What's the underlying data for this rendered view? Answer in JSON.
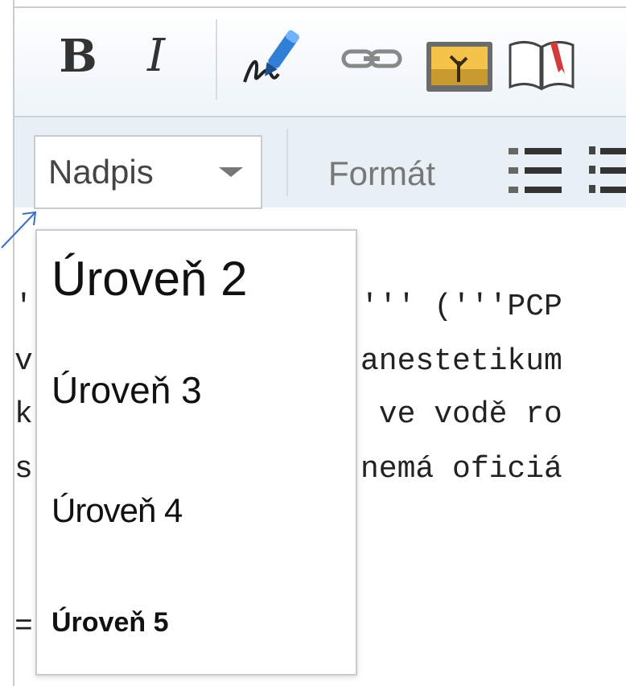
{
  "toolbar": {
    "bold_label": "B",
    "italic_label": "I",
    "heading_dropdown_label": "Nadpis",
    "format_label": "Formát",
    "icons": {
      "signature": "signature-icon",
      "link": "link-icon",
      "image": "image-icon",
      "reference": "book-icon",
      "bullet_list": "bullet-list-icon",
      "numbered_list": "numbered-list-icon"
    }
  },
  "heading_menu": {
    "items": [
      {
        "label": "Úroveň 2"
      },
      {
        "label": "Úroveň 3"
      },
      {
        "label": "Úroveň 4"
      },
      {
        "label": "Úroveň 5"
      }
    ]
  },
  "editor": {
    "lines": [
      "'",
      "v",
      "k",
      "s",
      "="
    ],
    "visible_right_fragments": [
      "''' ('''PCP",
      "anestetikum",
      " ve vodě ro",
      "nemá oficiá"
    ]
  },
  "colors": {
    "border": "#c8ccd1",
    "toolbar_bg": "#e8f0f6",
    "arrow": "#3a6fc4"
  }
}
